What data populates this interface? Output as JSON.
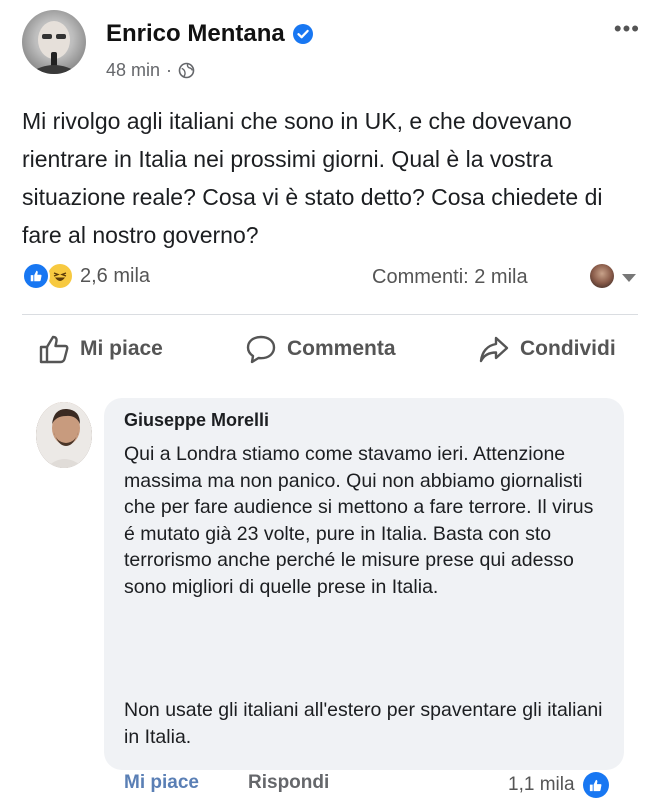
{
  "post": {
    "author": "Enrico Mentana",
    "time": "48 min",
    "dot": "·",
    "more_glyph": "•••",
    "text": "Mi rivolgo agli italiani che sono in UK, e che dovevano rientrare in Italia nei prossimi giorni. Qual è la vostra situazione reale? Cosa vi è stato detto? Cosa chiedete di fare al nostro governo?",
    "reactions_count": "2,6 mila",
    "comments_count": "Commenti: 2 mila"
  },
  "actions": {
    "like": "Mi piace",
    "comment": "Commenta",
    "share": "Condividi"
  },
  "comment": {
    "author": "Giuseppe Morelli",
    "text_p1": "Qui a Londra stiamo come stavamo ieri. Attenzione massima ma non panico. Qui non abbiamo giornalisti che per fare audience si mettono a fare terrore. Il virus é mutato già 23 volte, pure in Italia. Basta con sto terrorismo anche perché le misure prese qui adesso sono migliori di quelle prese in Italia.",
    "text_p2": "Non usate gli italiani all'estero per spaventare gli italiani in Italia.",
    "like_label": "Mi piace",
    "reply_label": "Rispondi",
    "likes": "1,1 mila"
  },
  "colors": {
    "brand_blue": "#1877f2",
    "comment_like_blue": "#5a7fb5",
    "bubble_bg": "#f0f2f5"
  },
  "icons": [
    "verified-badge-icon",
    "globe-icon",
    "more-icon",
    "like-reaction-icon",
    "haha-reaction-icon",
    "thumbs-up-icon",
    "comment-icon",
    "share-icon"
  ]
}
